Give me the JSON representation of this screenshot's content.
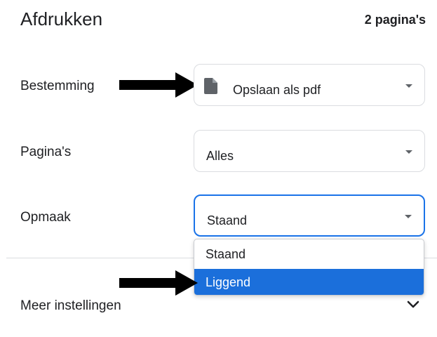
{
  "header": {
    "title": "Afdrukken",
    "page_count": "2 pagina's"
  },
  "destination": {
    "label": "Bestemming",
    "value": "Opslaan als pdf",
    "icon": "file-icon"
  },
  "pages": {
    "label": "Pagina's",
    "value": "Alles"
  },
  "layout": {
    "label": "Opmaak",
    "value": "Staand",
    "options": [
      "Staand",
      "Liggend"
    ],
    "highlighted_option": "Liggend"
  },
  "more_settings": {
    "label": "Meer instellingen",
    "icon": "chevron-down-icon"
  },
  "colors": {
    "accent": "#1a73e8",
    "highlight": "#1b6fdb",
    "arrow": "#000000"
  }
}
